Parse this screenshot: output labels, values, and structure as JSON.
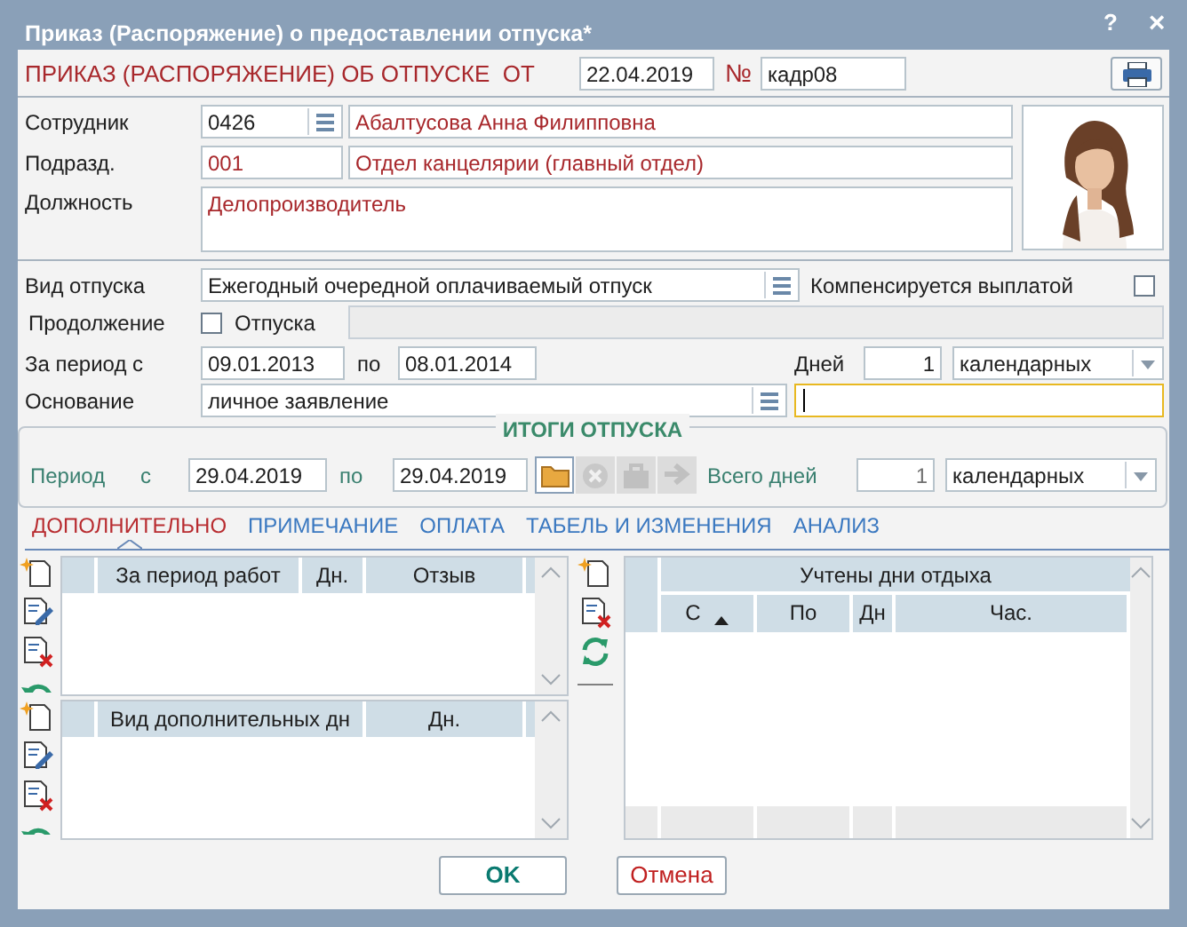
{
  "window": {
    "title": "Приказ (Распоряжение) о предоставлении отпуска*",
    "help_button": "?",
    "close_button": "×"
  },
  "header": {
    "title": "ПРИКАЗ (РАСПОРЯЖЕНИЕ) ОБ ОТПУСКЕ  ОТ",
    "date": "22.04.2019",
    "number_label": "№",
    "number": "кадр08"
  },
  "employee": {
    "label": "Сотрудник",
    "code": "0426",
    "name": "Абалтусова Анна Филипповна"
  },
  "department": {
    "label": "Подразд.",
    "code": "001",
    "name": "Отдел канцелярии (главный отдел)"
  },
  "position": {
    "label": "Должность",
    "value": "Делопроизводитель"
  },
  "leave_type": {
    "label": "Вид отпуска",
    "value": "Ежегодный очередной оплачиваемый отпуск",
    "compensated_label": "Компенсируется выплатой",
    "compensated_checked": false
  },
  "continuation": {
    "label": "Продолжение",
    "checked": false,
    "leave_label": "Отпуска"
  },
  "period": {
    "label": "За период с",
    "from": "09.01.2013",
    "to_label": "по",
    "to": "08.01.2014",
    "days_label": "Дней",
    "days": "1",
    "days_unit": "календарных"
  },
  "basis": {
    "label": "Основание",
    "value": "личное заявление"
  },
  "totals": {
    "title": "ИТОГИ ОТПУСКА",
    "period_label": "Период",
    "from_label": "с",
    "from": "29.04.2019",
    "to_label": "по",
    "to": "29.04.2019",
    "total_label": "Всего дней",
    "total": "1",
    "unit": "календарных",
    "buttons": [
      {
        "kind": "folder",
        "disabled": false
      },
      {
        "kind": "clear",
        "disabled": true
      },
      {
        "kind": "briefcase",
        "disabled": true
      },
      {
        "kind": "arrow",
        "disabled": true
      }
    ]
  },
  "tabs": [
    {
      "label": "ДОПОЛНИТЕЛЬНО",
      "selected": true
    },
    {
      "label": "ПРИМЕЧАНИЕ",
      "selected": false
    },
    {
      "label": "ОПЛАТА",
      "selected": false
    },
    {
      "label": "ТАБЕЛЬ И ИЗМЕНЕНИЯ",
      "selected": false
    },
    {
      "label": "АНАЛИЗ",
      "selected": false
    }
  ],
  "work_periods": {
    "columns": [
      "За период работ",
      "Дн.",
      "Отзыв"
    ]
  },
  "extra_days": {
    "columns": [
      "Вид дополнительных дн",
      "Дн."
    ]
  },
  "rest_days": {
    "group_header": "Учтены дни отдыха",
    "columns": [
      {
        "label": "С",
        "sorted": true
      },
      {
        "label": "По",
        "sorted": false
      },
      {
        "label": "Дн",
        "sorted": false
      },
      {
        "label": "Час.",
        "sorted": false
      }
    ]
  },
  "buttons": [
    {
      "label": "OK",
      "kind": "ok"
    },
    {
      "label": "Отмена",
      "kind": "cancel"
    }
  ]
}
